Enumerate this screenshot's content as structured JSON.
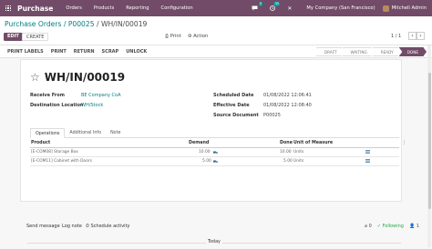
{
  "topbar": {
    "app_name": "Purchase",
    "menu": [
      "Orders",
      "Products",
      "Reporting",
      "Configuration"
    ],
    "chat_badge": "5",
    "activity_badge": "35",
    "company": "My Company (San Francisco)",
    "user": "Mitchell Admin"
  },
  "control": {
    "breadcrumb_link": "Purchase Orders / P00025",
    "breadcrumb_sep": " / ",
    "breadcrumb_current": "WH/IN/00019",
    "edit_label": "EDIT",
    "create_label": "CREATE",
    "print_label": "Print",
    "action_label": "Action",
    "pager": "1 / 1"
  },
  "statusbar": {
    "buttons": [
      "PRINT LABELS",
      "PRINT",
      "RETURN",
      "SCRAP",
      "UNLOCK"
    ],
    "stages": [
      "DRAFT",
      "WAITING",
      "READY",
      "DONE"
    ],
    "active_stage": "DONE"
  },
  "record": {
    "title": "WH/IN/00019",
    "receive_from_label": "Receive From",
    "receive_from": "BE Company CoA",
    "destination_label": "Destination Location",
    "destination": "WH/Stock",
    "scheduled_label": "Scheduled Date",
    "scheduled": "01/08/2022 12:06:41",
    "effective_label": "Effective Date",
    "effective": "01/08/2022 12:08:40",
    "source_label": "Source Document",
    "source": "P00025"
  },
  "tabs": [
    "Operations",
    "Additional Info",
    "Note"
  ],
  "table": {
    "headers": [
      "Product",
      "Demand",
      "Done",
      "Unit of Measure"
    ],
    "rows": [
      {
        "product": "[E-COM08] Storage Box",
        "demand": "10.00",
        "done": "10.00",
        "uom": "Units"
      },
      {
        "product": "[E-COM11] Cabinet with Doors",
        "demand": "5.00",
        "done": "5.00",
        "uom": "Units"
      }
    ]
  },
  "chatter": {
    "send_message": "Send message",
    "log_note": "Log note",
    "schedule_activity": "Schedule activity",
    "attachments": "0",
    "following": "Following",
    "followers": "1",
    "today": "Today"
  },
  "colors": {
    "brand": "#714b67",
    "link": "#017e84"
  }
}
